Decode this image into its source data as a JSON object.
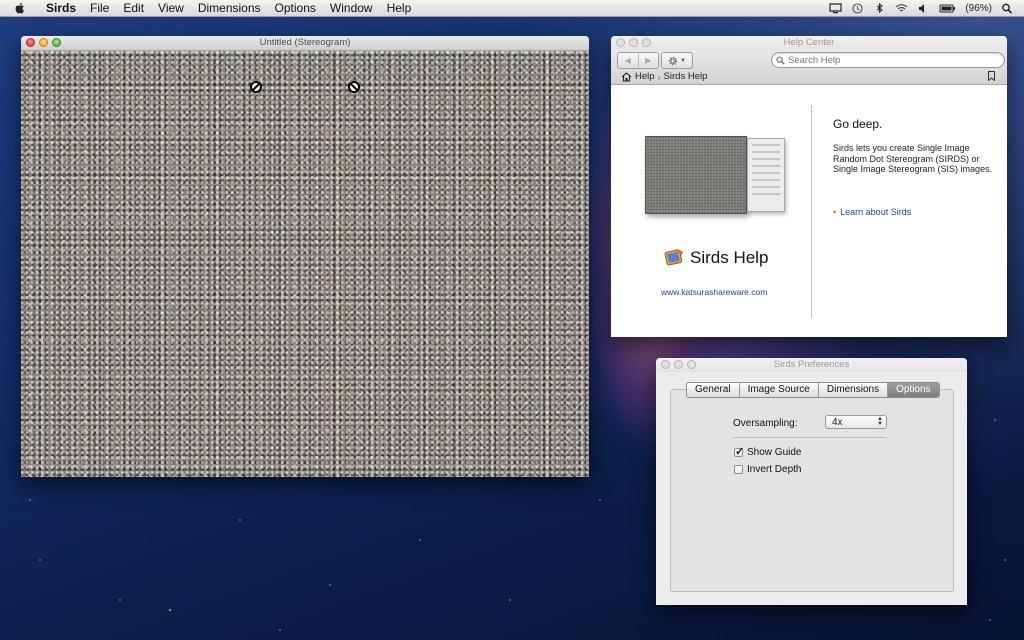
{
  "menubar": {
    "app_name": "Sirds",
    "items": [
      "File",
      "Edit",
      "View",
      "Dimensions",
      "Options",
      "Window",
      "Help"
    ],
    "battery": "(96%)",
    "status_icons": [
      "display-icon",
      "time-machine-icon",
      "bluetooth-icon",
      "wifi-icon",
      "volume-icon",
      "battery-icon",
      "spotlight-icon"
    ]
  },
  "stereogram_window": {
    "title": "Untitled (Stereogram)"
  },
  "help_window": {
    "title": "Help Center",
    "search_placeholder": "Search Help",
    "breadcrumb": [
      "Help",
      "Sirds Help"
    ],
    "logo_text": "Sirds Help",
    "website": "www.katsurashareware.com",
    "heading": "Go deep.",
    "body": "Sirds lets you create Single Image Random Dot Stereogram (SIRDS) or Single Image Stereogram (SIS) images.",
    "learn_link": "Learn about Sirds"
  },
  "prefs_window": {
    "title": "Sirds Preferences",
    "tabs": [
      "General",
      "Image Source",
      "Dimensions",
      "Options"
    ],
    "active_tab": "Options",
    "oversampling_label": "Oversampling:",
    "oversampling_value": "4x",
    "show_guide_label": "Show Guide",
    "show_guide_checked": true,
    "invert_depth_label": "Invert Depth",
    "invert_depth_checked": false
  },
  "colors": {
    "link": "#1d3fb8",
    "bullet": "#e55b14",
    "active_tab": "#8a8a8a"
  }
}
